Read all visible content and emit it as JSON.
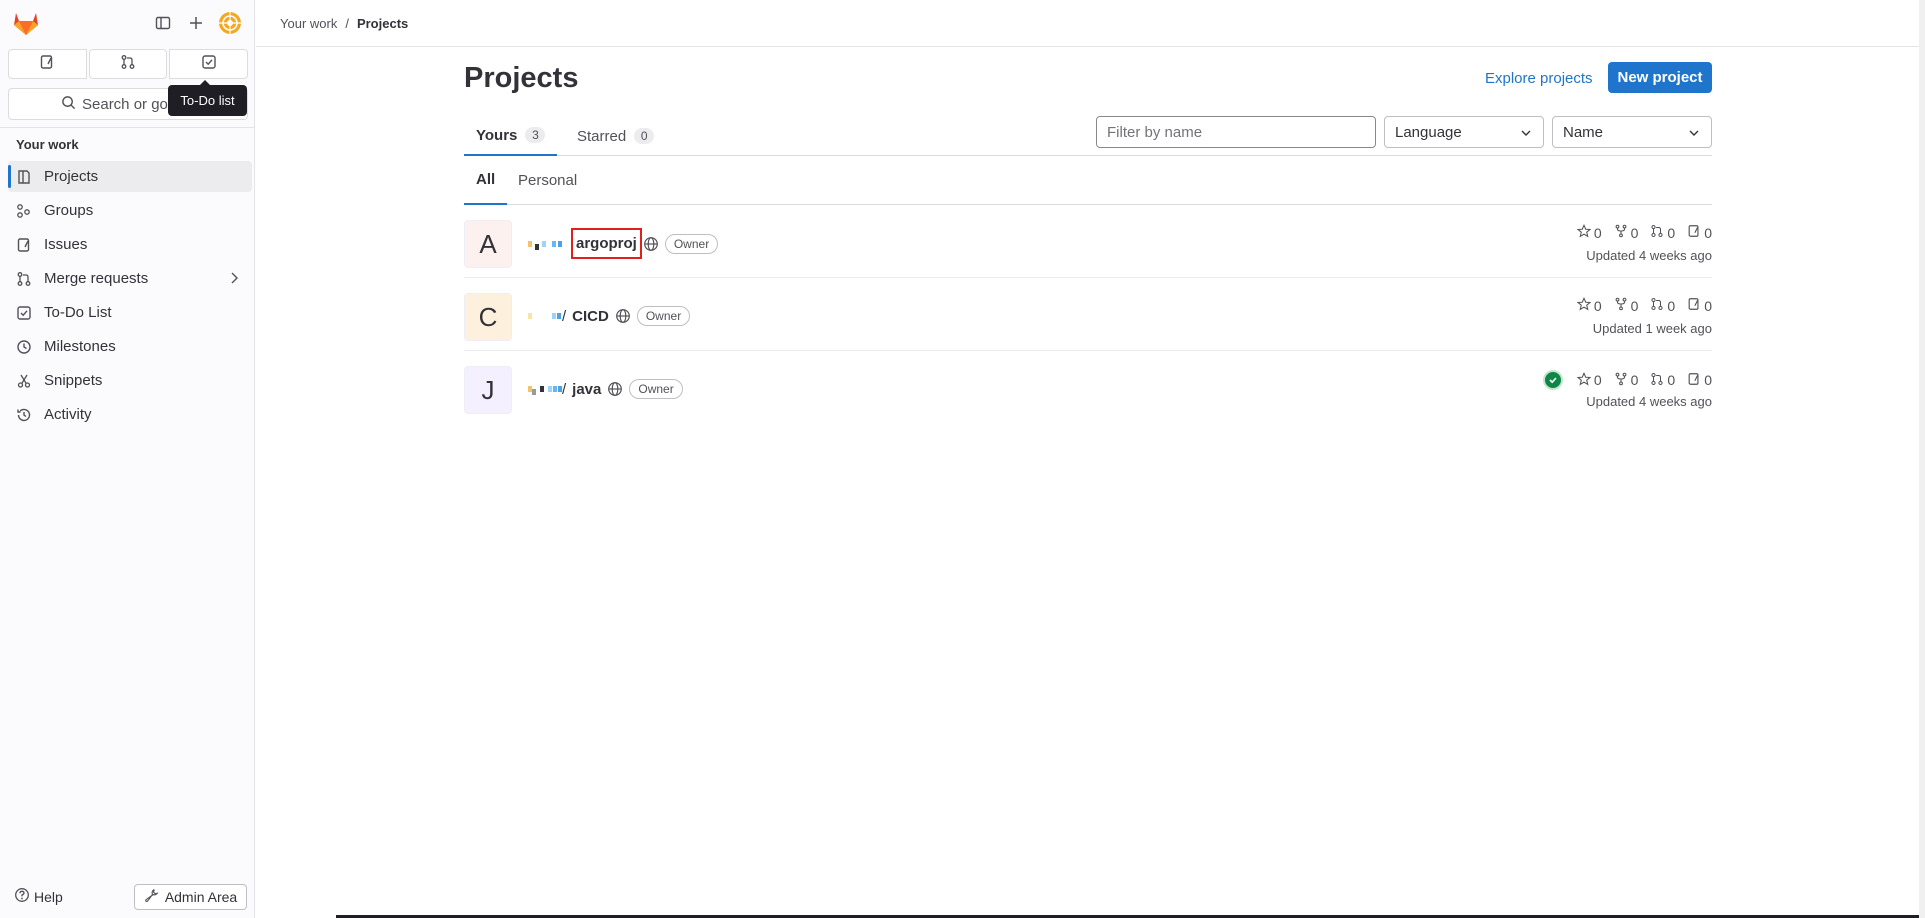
{
  "sidebar": {
    "counts": [
      {
        "icon": "issues-icon"
      },
      {
        "icon": "merge-request-icon"
      },
      {
        "icon": "todo-icon"
      }
    ],
    "search_label": "Search or go",
    "tooltip": "To-Do list",
    "section_title": "Your work",
    "items": [
      {
        "label": "Projects",
        "icon": "project-icon",
        "active": true
      },
      {
        "label": "Groups",
        "icon": "group-icon"
      },
      {
        "label": "Issues",
        "icon": "issues-icon"
      },
      {
        "label": "Merge requests",
        "icon": "merge-request-icon"
      },
      {
        "label": "To-Do List",
        "icon": "todo-icon"
      },
      {
        "label": "Milestones",
        "icon": "milestone-icon"
      },
      {
        "label": "Snippets",
        "icon": "snippet-icon"
      },
      {
        "label": "Activity",
        "icon": "history-icon"
      }
    ],
    "help_label": "Help",
    "admin_label": "Admin Area"
  },
  "breadcrumb": {
    "parent": "Your work",
    "separator": "/",
    "current": "Projects"
  },
  "main": {
    "title": "Projects",
    "explore_label": "Explore projects",
    "new_project_label": "New project",
    "tabs": [
      {
        "label": "Yours",
        "count": "3",
        "active": true
      },
      {
        "label": "Starred",
        "count": "0"
      }
    ],
    "filter_placeholder": "Filter by name",
    "language_select": "Language",
    "sort_select": "Name",
    "subtabs": [
      {
        "label": "All",
        "active": true
      },
      {
        "label": "Personal"
      }
    ]
  },
  "projects": [
    {
      "initial": "A",
      "avatar_bg": "#fcf1ef",
      "prefix": "",
      "name": "argoproj",
      "role": "Owner",
      "stars": "0",
      "forks": "0",
      "mrs": "0",
      "issues": "0",
      "updated": "Updated 4 weeks ago",
      "pipeline": false
    },
    {
      "initial": "C",
      "avatar_bg": "#fdf1dd",
      "prefix": "/",
      "name": "CICD",
      "role": "Owner",
      "stars": "0",
      "forks": "0",
      "mrs": "0",
      "issues": "0",
      "updated": "Updated 1 week ago",
      "pipeline": false
    },
    {
      "initial": "J",
      "avatar_bg": "#f4f0ff",
      "prefix": "/",
      "name": "java",
      "role": "Owner",
      "stars": "0",
      "forks": "0",
      "mrs": "0",
      "issues": "0",
      "updated": "Updated 4 weeks ago",
      "pipeline": true
    }
  ],
  "colors": {
    "accent": "#1f75cb",
    "highlight_box": "#e0201b",
    "pipeline_success": "#108548"
  }
}
